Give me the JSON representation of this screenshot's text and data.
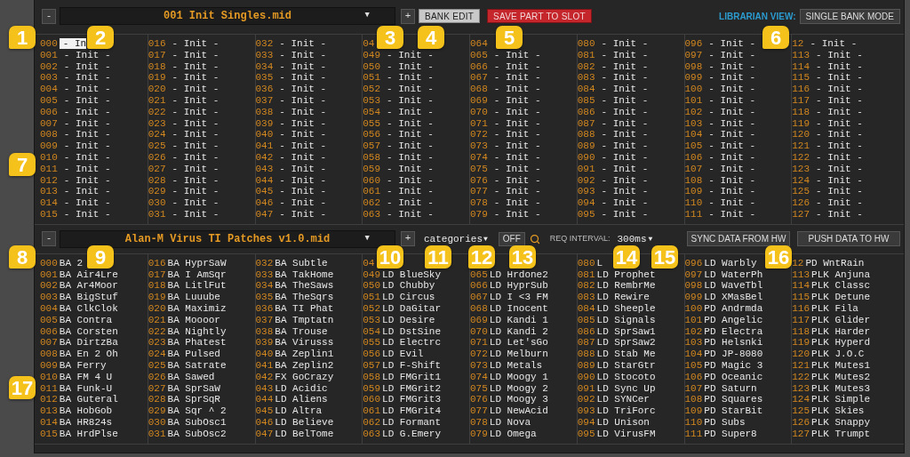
{
  "bank_a": {
    "remove": "-",
    "file": "001 Init Singles.mid",
    "caret": "▼",
    "add": "+",
    "buttons": [
      {
        "label": "BANK EDIT",
        "kind": "toggle"
      },
      {
        "label": "SAVE PART TO SLOT",
        "kind": "danger"
      }
    ],
    "view_label": "LIBRARIAN VIEW:",
    "view_mode": "SINGLE BANK MODE",
    "columns": [
      [
        {
          "number": "000",
          "name": "- In",
          "selected": true
        },
        {
          "number": "001",
          "name": "- Init -",
          "selected": false
        },
        {
          "number": "002",
          "name": "- Init -",
          "selected": false
        },
        {
          "number": "003",
          "name": "- Init -",
          "selected": false
        },
        {
          "number": "004",
          "name": "- Init -",
          "selected": false
        },
        {
          "number": "005",
          "name": "- Init -",
          "selected": false
        },
        {
          "number": "006",
          "name": "- Init -",
          "selected": false
        },
        {
          "number": "007",
          "name": "- Init -",
          "selected": false
        },
        {
          "number": "008",
          "name": "- Init -",
          "selected": false
        },
        {
          "number": "009",
          "name": "- Init -",
          "selected": false
        },
        {
          "number": "010",
          "name": "- Init -",
          "selected": false
        },
        {
          "number": "011",
          "name": "- Init -",
          "selected": false
        },
        {
          "number": "012",
          "name": "- Init -",
          "selected": false
        },
        {
          "number": "013",
          "name": "- Init -",
          "selected": false
        },
        {
          "number": "014",
          "name": "- Init -",
          "selected": false
        },
        {
          "number": "015",
          "name": "- Init -",
          "selected": false
        }
      ],
      [
        {
          "number": "016",
          "name": "- Init -",
          "selected": false
        },
        {
          "number": "017",
          "name": "- Init -",
          "selected": false
        },
        {
          "number": "018",
          "name": "- Init -",
          "selected": false
        },
        {
          "number": "019",
          "name": "- Init -",
          "selected": false
        },
        {
          "number": "020",
          "name": "- Init -",
          "selected": false
        },
        {
          "number": "021",
          "name": "- Init -",
          "selected": false
        },
        {
          "number": "022",
          "name": "- Init -",
          "selected": false
        },
        {
          "number": "023",
          "name": "- Init -",
          "selected": false
        },
        {
          "number": "024",
          "name": "- Init -",
          "selected": false
        },
        {
          "number": "025",
          "name": "- Init -",
          "selected": false
        },
        {
          "number": "026",
          "name": "- Init -",
          "selected": false
        },
        {
          "number": "027",
          "name": "- Init -",
          "selected": false
        },
        {
          "number": "028",
          "name": "- Init -",
          "selected": false
        },
        {
          "number": "029",
          "name": "- Init -",
          "selected": false
        },
        {
          "number": "030",
          "name": "- Init -",
          "selected": false
        },
        {
          "number": "031",
          "name": "- Init -",
          "selected": false
        }
      ],
      [
        {
          "number": "032",
          "name": "- Init -",
          "selected": false
        },
        {
          "number": "033",
          "name": "- Init -",
          "selected": false
        },
        {
          "number": "034",
          "name": "- Init -",
          "selected": false
        },
        {
          "number": "035",
          "name": "- Init -",
          "selected": false
        },
        {
          "number": "036",
          "name": "- Init -",
          "selected": false
        },
        {
          "number": "037",
          "name": "- Init -",
          "selected": false
        },
        {
          "number": "038",
          "name": "- Init -",
          "selected": false
        },
        {
          "number": "039",
          "name": "- Init -",
          "selected": false
        },
        {
          "number": "040",
          "name": "- Init -",
          "selected": false
        },
        {
          "number": "041",
          "name": "- Init -",
          "selected": false
        },
        {
          "number": "042",
          "name": "- Init -",
          "selected": false
        },
        {
          "number": "043",
          "name": "- Init -",
          "selected": false
        },
        {
          "number": "044",
          "name": "- Init -",
          "selected": false
        },
        {
          "number": "045",
          "name": "- Init -",
          "selected": false
        },
        {
          "number": "046",
          "name": "- Init -",
          "selected": false
        },
        {
          "number": "047",
          "name": "- Init -",
          "selected": false
        }
      ],
      [
        {
          "number": "04",
          "selected": false
        },
        {
          "number": "049",
          "name": "- Init -",
          "selected": false
        },
        {
          "number": "050",
          "name": "- Init -",
          "selected": false
        },
        {
          "number": "051",
          "name": "- Init -",
          "selected": false
        },
        {
          "number": "052",
          "name": "- Init -",
          "selected": false
        },
        {
          "number": "053",
          "name": "- Init -",
          "selected": false
        },
        {
          "number": "054",
          "name": "- Init -",
          "selected": false
        },
        {
          "number": "055",
          "name": "- Init -",
          "selected": false
        },
        {
          "number": "056",
          "name": "- Init -",
          "selected": false
        },
        {
          "number": "057",
          "name": "- Init -",
          "selected": false
        },
        {
          "number": "058",
          "name": "- Init -",
          "selected": false
        },
        {
          "number": "059",
          "name": "- Init -",
          "selected": false
        },
        {
          "number": "060",
          "name": "- Init -",
          "selected": false
        },
        {
          "number": "061",
          "name": "- Init -",
          "selected": false
        },
        {
          "number": "062",
          "name": "- Init -",
          "selected": false
        },
        {
          "number": "063",
          "name": "- Init -",
          "selected": false
        }
      ],
      [
        {
          "number": "064",
          "selected": false
        },
        {
          "number": "065",
          "name": "- Init -",
          "selected": false
        },
        {
          "number": "066",
          "name": "- Init -",
          "selected": false
        },
        {
          "number": "067",
          "name": "- Init -",
          "selected": false
        },
        {
          "number": "068",
          "name": "- Init -",
          "selected": false
        },
        {
          "number": "069",
          "name": "- Init -",
          "selected": false
        },
        {
          "number": "070",
          "name": "- Init -",
          "selected": false
        },
        {
          "number": "071",
          "name": "- Init -",
          "selected": false
        },
        {
          "number": "072",
          "name": "- Init -",
          "selected": false
        },
        {
          "number": "073",
          "name": "- Init -",
          "selected": false
        },
        {
          "number": "074",
          "name": "- Init -",
          "selected": false
        },
        {
          "number": "075",
          "name": "- Init -",
          "selected": false
        },
        {
          "number": "076",
          "name": "- Init -",
          "selected": false
        },
        {
          "number": "077",
          "name": "- Init -",
          "selected": false
        },
        {
          "number": "078",
          "name": "- Init -",
          "selected": false
        },
        {
          "number": "079",
          "name": "- Init -",
          "selected": false
        }
      ],
      [
        {
          "number": "080",
          "name": "- Init -",
          "selected": false
        },
        {
          "number": "081",
          "name": "- Init -",
          "selected": false
        },
        {
          "number": "082",
          "name": "- Init -",
          "selected": false
        },
        {
          "number": "083",
          "name": "- Init -",
          "selected": false
        },
        {
          "number": "084",
          "name": "- Init -",
          "selected": false
        },
        {
          "number": "085",
          "name": "- Init -",
          "selected": false
        },
        {
          "number": "086",
          "name": "- Init -",
          "selected": false
        },
        {
          "number": "087",
          "name": "- Init -",
          "selected": false
        },
        {
          "number": "088",
          "name": "- Init -",
          "selected": false
        },
        {
          "number": "089",
          "name": "- Init -",
          "selected": false
        },
        {
          "number": "090",
          "name": "- Init -",
          "selected": false
        },
        {
          "number": "091",
          "name": "- Init -",
          "selected": false
        },
        {
          "number": "092",
          "name": "- Init -",
          "selected": false
        },
        {
          "number": "093",
          "name": "- Init -",
          "selected": false
        },
        {
          "number": "094",
          "name": "- Init -",
          "selected": false
        },
        {
          "number": "095",
          "name": "- Init -",
          "selected": false
        }
      ],
      [
        {
          "number": "096",
          "name": "- Init -",
          "selected": false
        },
        {
          "number": "097",
          "name": "- Init -",
          "selected": false
        },
        {
          "number": "098",
          "name": "- Init -",
          "selected": false
        },
        {
          "number": "099",
          "name": "- Init -",
          "selected": false
        },
        {
          "number": "100",
          "name": "- Init -",
          "selected": false
        },
        {
          "number": "101",
          "name": "- Init -",
          "selected": false
        },
        {
          "number": "102",
          "name": "- Init -",
          "selected": false
        },
        {
          "number": "103",
          "name": "- Init -",
          "selected": false
        },
        {
          "number": "104",
          "name": "- Init -",
          "selected": false
        },
        {
          "number": "105",
          "name": "- Init -",
          "selected": false
        },
        {
          "number": "106",
          "name": "- Init -",
          "selected": false
        },
        {
          "number": "107",
          "name": "- Init -",
          "selected": false
        },
        {
          "number": "108",
          "name": "- Init -",
          "selected": false
        },
        {
          "number": "109",
          "name": "- Init -",
          "selected": false
        },
        {
          "number": "110",
          "name": "- Init -",
          "selected": false
        },
        {
          "number": "111",
          "name": "- Init -",
          "selected": false
        }
      ],
      [
        {
          "number": "12",
          "name": "- Init -",
          "selected": false
        },
        {
          "number": "113",
          "name": "- Init -",
          "selected": false
        },
        {
          "number": "114",
          "name": "- Init -",
          "selected": false
        },
        {
          "number": "115",
          "name": "- Init -",
          "selected": false
        },
        {
          "number": "116",
          "name": "- Init -",
          "selected": false
        },
        {
          "number": "117",
          "name": "- Init -",
          "selected": false
        },
        {
          "number": "118",
          "name": "- Init -",
          "selected": false
        },
        {
          "number": "119",
          "name": "- Init -",
          "selected": false
        },
        {
          "number": "120",
          "name": "- Init -",
          "selected": false
        },
        {
          "number": "121",
          "name": "- Init -",
          "selected": false
        },
        {
          "number": "122",
          "name": "- Init -",
          "selected": false
        },
        {
          "number": "123",
          "name": "- Init -",
          "selected": false
        },
        {
          "number": "124",
          "name": "- Init -",
          "selected": false
        },
        {
          "number": "125",
          "name": "- Init -",
          "selected": false
        },
        {
          "number": "126",
          "name": "- Init -",
          "selected": false
        },
        {
          "number": "127",
          "name": "- Init -",
          "selected": false
        }
      ]
    ]
  },
  "bank_b": {
    "remove": "-",
    "file": "Alan-M Virus TI Patches v1.0.mid",
    "caret": "▼",
    "add": "+",
    "filter": {
      "value": "categories",
      "caret": "▼"
    },
    "off": "OFF",
    "interval_label": "REQ INTERVAL:",
    "interval": {
      "value": "300ms",
      "caret": "▼"
    },
    "buttons": [
      {
        "label": "SYNC DATA FROM HW"
      },
      {
        "label": "PUSH DATA TO HW"
      }
    ],
    "columns": [
      [
        {
          "number": "000",
          "name": "BA 2"
        },
        {
          "number": "001",
          "name": "BA Air4Lre"
        },
        {
          "number": "002",
          "name": "BA Ar4Moor"
        },
        {
          "number": "003",
          "name": "BA BigStuf"
        },
        {
          "number": "004",
          "name": "BA ClkClok"
        },
        {
          "number": "005",
          "name": "BA Contra"
        },
        {
          "number": "006",
          "name": "BA Corsten"
        },
        {
          "number": "007",
          "name": "BA DirtzBa"
        },
        {
          "number": "008",
          "name": "BA En 2 Oh"
        },
        {
          "number": "009",
          "name": "BA Ferry"
        },
        {
          "number": "010",
          "name": "BA FM 4 U"
        },
        {
          "number": "011",
          "name": "BA Funk-U"
        },
        {
          "number": "012",
          "name": "BA Guteral"
        },
        {
          "number": "013",
          "name": "BA HobGob"
        },
        {
          "number": "014",
          "name": "BA HR824s"
        },
        {
          "number": "015",
          "name": "BA HrdPlse"
        }
      ],
      [
        {
          "number": "016",
          "name": "BA HyprSaW"
        },
        {
          "number": "017",
          "name": "BA I AmSqr"
        },
        {
          "number": "018",
          "name": "BA LitlFut"
        },
        {
          "number": "019",
          "name": "BA Luuube"
        },
        {
          "number": "020",
          "name": "BA Maximiz"
        },
        {
          "number": "021",
          "name": "BA Moooor"
        },
        {
          "number": "022",
          "name": "BA Nightly"
        },
        {
          "number": "023",
          "name": "BA Phatest"
        },
        {
          "number": "024",
          "name": "BA Pulsed"
        },
        {
          "number": "025",
          "name": "BA Satrate"
        },
        {
          "number": "026",
          "name": "BA Sawed"
        },
        {
          "number": "027",
          "name": "BA SprSaW"
        },
        {
          "number": "028",
          "name": "BA SprSqR"
        },
        {
          "number": "029",
          "name": "BA Sqr ^ 2"
        },
        {
          "number": "030",
          "name": "BA SubOsc1"
        },
        {
          "number": "031",
          "name": "BA SubOsc2"
        }
      ],
      [
        {
          "number": "032",
          "name": "BA Subtle"
        },
        {
          "number": "033",
          "name": "BA TakHome"
        },
        {
          "number": "034",
          "name": "BA TheSaws"
        },
        {
          "number": "035",
          "name": "BA TheSqrs"
        },
        {
          "number": "036",
          "name": "BA TI Phat"
        },
        {
          "number": "037",
          "name": "BA Tmptatn"
        },
        {
          "number": "038",
          "name": "BA Trouse"
        },
        {
          "number": "039",
          "name": "BA Virusss"
        },
        {
          "number": "040",
          "name": "BA Zeplin1"
        },
        {
          "number": "041",
          "name": "BA Zeplin2"
        },
        {
          "number": "042",
          "name": "FX GoCrazy"
        },
        {
          "number": "043",
          "name": "LD Acidic"
        },
        {
          "number": "044",
          "name": "LD Aliens"
        },
        {
          "number": "045",
          "name": "LD Altra"
        },
        {
          "number": "046",
          "name": "LD Believe"
        },
        {
          "number": "047",
          "name": "LD BelTome"
        }
      ],
      [
        {
          "number": "04"
        },
        {
          "number": "049",
          "name": "LD BlueSky"
        },
        {
          "number": "050",
          "name": "LD Chubby"
        },
        {
          "number": "051",
          "name": "LD Circus"
        },
        {
          "number": "052",
          "name": "LD DaGitar"
        },
        {
          "number": "053",
          "name": "LD Desire"
        },
        {
          "number": "054",
          "name": "LD DstSine"
        },
        {
          "number": "055",
          "name": "LD Electrc"
        },
        {
          "number": "056",
          "name": "LD Evil"
        },
        {
          "number": "057",
          "name": "LD F-Shift"
        },
        {
          "number": "058",
          "name": "LD FMGrit1"
        },
        {
          "number": "059",
          "name": "LD FMGrit2"
        },
        {
          "number": "060",
          "name": "LD FMGrit3"
        },
        {
          "number": "061",
          "name": "LD FMGrit4"
        },
        {
          "number": "062",
          "name": "LD Formant"
        },
        {
          "number": "063",
          "name": "LD G.Emery"
        }
      ],
      [
        {},
        {
          "number": "065",
          "name": "LD Hrdone2"
        },
        {
          "number": "066",
          "name": "LD HyprSub"
        },
        {
          "number": "067",
          "name": "LD I <3 FM"
        },
        {
          "number": "068",
          "name": "LD Inocent"
        },
        {
          "number": "069",
          "name": "LD Kandi 1"
        },
        {
          "number": "070",
          "name": "LD Kandi 2"
        },
        {
          "number": "071",
          "name": "LD Let'sGo"
        },
        {
          "number": "072",
          "name": "LD Melburn"
        },
        {
          "number": "073",
          "name": "LD Metals"
        },
        {
          "number": "074",
          "name": "LD Moogy 1"
        },
        {
          "number": "075",
          "name": "LD Moogy 2"
        },
        {
          "number": "076",
          "name": "LD Moogy 3"
        },
        {
          "number": "077",
          "name": "LD NewAcid"
        },
        {
          "number": "078",
          "name": "LD Nova"
        },
        {
          "number": "079",
          "name": "LD Omega"
        }
      ],
      [
        {
          "number": "080",
          "name": "L"
        },
        {
          "number": "081",
          "name": "LD Prophet"
        },
        {
          "number": "082",
          "name": "LD RembrMe"
        },
        {
          "number": "083",
          "name": "LD Rewire"
        },
        {
          "number": "084",
          "name": "LD Sheeple"
        },
        {
          "number": "085",
          "name": "LD Signals"
        },
        {
          "number": "086",
          "name": "LD SprSaw1"
        },
        {
          "number": "087",
          "name": "LD SprSaw2"
        },
        {
          "number": "088",
          "name": "LD Stab Me"
        },
        {
          "number": "089",
          "name": "LD StarGtr"
        },
        {
          "number": "090",
          "name": "LD Stocoto"
        },
        {
          "number": "091",
          "name": "LD Sync Up"
        },
        {
          "number": "092",
          "name": "LD SYNCer"
        },
        {
          "number": "093",
          "name": "LD TriForc"
        },
        {
          "number": "094",
          "name": "LD Unison"
        },
        {
          "number": "095",
          "name": "LD VirusFM"
        }
      ],
      [
        {
          "number": "096",
          "name": "LD Warbly"
        },
        {
          "number": "097",
          "name": "LD WaterPh"
        },
        {
          "number": "098",
          "name": "LD WaveTbl"
        },
        {
          "number": "099",
          "name": "LD XMasBel"
        },
        {
          "number": "100",
          "name": "PD Andrmda"
        },
        {
          "number": "101",
          "name": "PD Angelic"
        },
        {
          "number": "102",
          "name": "PD Electra"
        },
        {
          "number": "103",
          "name": "PD Helsnki"
        },
        {
          "number": "104",
          "name": "PD JP-8080"
        },
        {
          "number": "105",
          "name": "PD Magic 3"
        },
        {
          "number": "106",
          "name": "PD Oceanic"
        },
        {
          "number": "107",
          "name": "PD Saturn"
        },
        {
          "number": "108",
          "name": "PD Squares"
        },
        {
          "number": "109",
          "name": "PD StarBit"
        },
        {
          "number": "110",
          "name": "PD Subs"
        },
        {
          "number": "111",
          "name": "PD Super8"
        }
      ],
      [
        {
          "number": "12",
          "name": "PD WntRain"
        },
        {
          "number": "113",
          "name": "PLK Anjuna"
        },
        {
          "number": "114",
          "name": "PLK Classc"
        },
        {
          "number": "115",
          "name": "PLK Detune"
        },
        {
          "number": "116",
          "name": "PLK Fila"
        },
        {
          "number": "117",
          "name": "PLK Glider"
        },
        {
          "number": "118",
          "name": "PLK Harder"
        },
        {
          "number": "119",
          "name": "PLK Hyperd"
        },
        {
          "number": "120",
          "name": "PLK J.O.C"
        },
        {
          "number": "121",
          "name": "PLK Mutes1"
        },
        {
          "number": "122",
          "name": "PLK Mutes2"
        },
        {
          "number": "123",
          "name": "PLK Mutes3"
        },
        {
          "number": "124",
          "name": "PLK Simple"
        },
        {
          "number": "125",
          "name": "PLK Skies"
        },
        {
          "number": "126",
          "name": "PLK Snappy"
        },
        {
          "number": "127",
          "name": "PLK Trumpt"
        }
      ]
    ]
  },
  "callouts": [
    {
      "label": "1"
    },
    {
      "label": "2"
    },
    {
      "label": "3"
    },
    {
      "label": "4"
    },
    {
      "label": "5"
    },
    {
      "label": "6"
    },
    {
      "label": "7"
    },
    {
      "label": "8"
    },
    {
      "label": "9"
    },
    {
      "label": "10"
    },
    {
      "label": "11"
    },
    {
      "label": "12"
    },
    {
      "label": "13"
    },
    {
      "label": "14"
    },
    {
      "label": "15"
    },
    {
      "label": "16"
    },
    {
      "label": "17"
    }
  ]
}
